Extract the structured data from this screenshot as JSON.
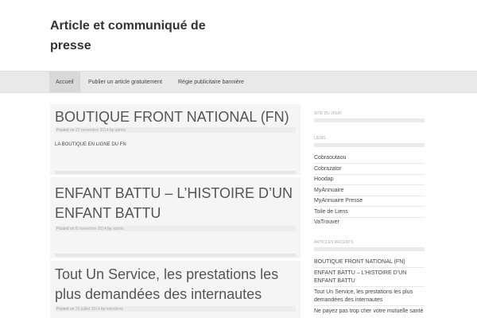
{
  "site": {
    "title": "Article et communiqué de presse"
  },
  "nav": {
    "items": [
      {
        "label": "Accueil"
      },
      {
        "label": "Publier un article gratuitement"
      },
      {
        "label": "Régie publicitaire bannière"
      }
    ]
  },
  "posts": [
    {
      "title": "BOUTIQUE FRONT NATIONAL (FN)",
      "meta_prefix": "Posted on",
      "date": "22 novembre 2014",
      "by": "by",
      "author": "admin",
      "excerpt": "LA BOUTIQUE EN LIGNE DU FN"
    },
    {
      "title": "ENFANT BATTU – L’HISTOIRE D’UN ENFANT BATTU",
      "meta_prefix": "Posted on",
      "date": "8 novembre 2014",
      "by": "by",
      "author": "admin"
    },
    {
      "title": "Tout Un Service, les prestations les plus demandées des internautes",
      "meta_prefix": "Posted on",
      "date": "20 juillet 2014",
      "by": "by",
      "author": "toilediens"
    }
  ],
  "sidebar": {
    "site_du_jour": {
      "title": "SITE DU JOUR"
    },
    "liens": {
      "title": "LIENS",
      "links": [
        "Cobraoutaou",
        "Cobrazator",
        "Hoodap",
        "MyAnnuaire",
        "MyAnnuaire Presse",
        "Toile de Liens",
        "VaTrouver"
      ]
    },
    "recent": {
      "title": "ARTICLES RÉCENTS",
      "links": [
        "BOUTIQUE FRONT NATIONAL (FN)",
        "ENFANT BATTU – L’HISTOIRE D’UN ENFANT BATTU",
        "Tout Un Service, les prestations les plus demandées des internautes",
        "Ne payez pas trop cher votre mutuelle santé"
      ]
    }
  }
}
